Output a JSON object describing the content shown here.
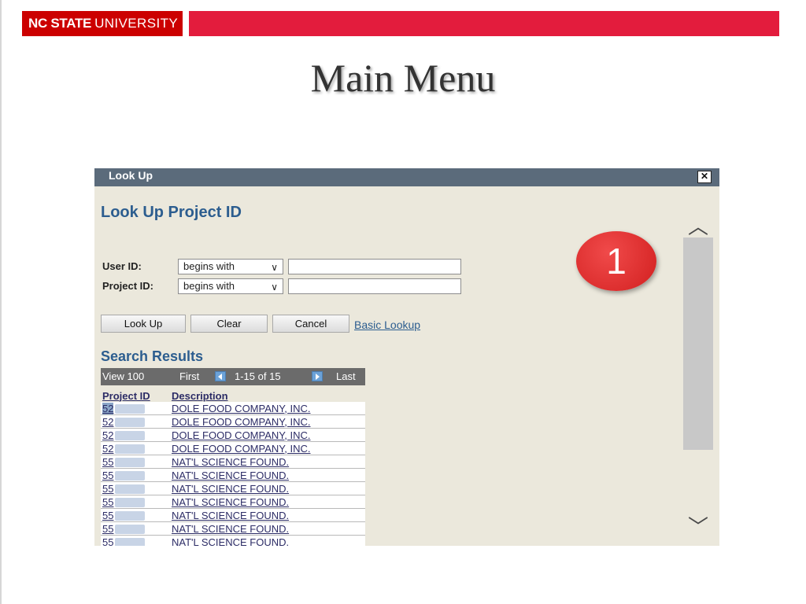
{
  "header": {
    "logo_bold": "NC STATE",
    "logo_light": "UNIVERSITY",
    "slide_title": "Main Menu"
  },
  "lookup": {
    "window_title": "Look Up",
    "close_symbol": "✕",
    "heading": "Look Up Project ID",
    "criteria": [
      {
        "label": "User ID:",
        "operator": "begins with",
        "value": ""
      },
      {
        "label": "Project ID:",
        "operator": "begins with",
        "value": ""
      }
    ],
    "buttons": {
      "look_up": "Look Up",
      "clear": "Clear",
      "cancel": "Cancel"
    },
    "basic_lookup_link": "Basic Lookup",
    "results_heading": "Search Results",
    "nav": {
      "view": "View 100",
      "first": "First",
      "range": "1-15 of 15",
      "last": "Last"
    },
    "columns": [
      "Project ID",
      "Description"
    ],
    "rows": [
      {
        "id_prefix": "52",
        "description": "DOLE FOOD COMPANY, INC."
      },
      {
        "id_prefix": "52",
        "description": "DOLE FOOD COMPANY, INC."
      },
      {
        "id_prefix": "52",
        "description": "DOLE FOOD COMPANY, INC."
      },
      {
        "id_prefix": "52",
        "description": "DOLE FOOD COMPANY, INC."
      },
      {
        "id_prefix": "55",
        "description": "NAT'L SCIENCE FOUND."
      },
      {
        "id_prefix": "55",
        "description": "NAT'L SCIENCE FOUND."
      },
      {
        "id_prefix": "55",
        "description": "NAT'L SCIENCE FOUND."
      },
      {
        "id_prefix": "55",
        "description": "NAT'L SCIENCE FOUND."
      },
      {
        "id_prefix": "55",
        "description": "NAT'L SCIENCE FOUND."
      },
      {
        "id_prefix": "55",
        "description": "NAT'L SCIENCE FOUND."
      },
      {
        "id_prefix": "55",
        "description": "NAT'L SCIENCE FOUND."
      }
    ],
    "scroll_up": "︿",
    "scroll_down": "﹀"
  },
  "callout": {
    "number": "1"
  },
  "colors": {
    "nc_red": "#cc0000",
    "banner_red": "#e31c3d",
    "link_blue": "#2c5d8f",
    "titlebar": "#5b6b7b"
  }
}
